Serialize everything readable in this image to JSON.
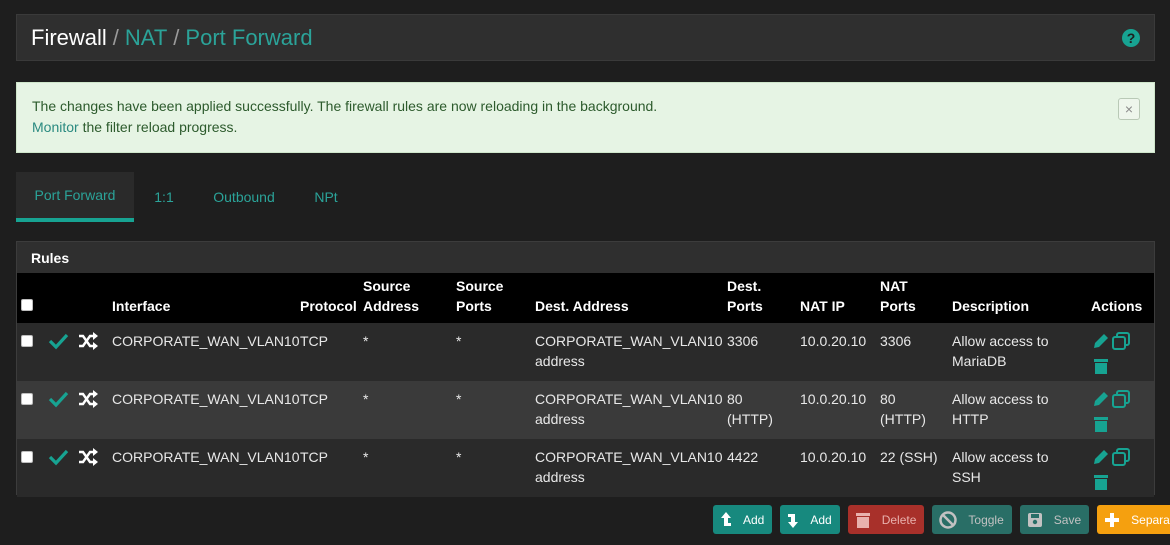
{
  "breadcrumb": {
    "root": "Firewall",
    "sep": "/",
    "nat": "NAT",
    "current": "Port Forward",
    "help": "?"
  },
  "alert": {
    "line1": "The changes have been applied successfully. The firewall rules are now reloading in the background.",
    "link": "Monitor",
    "line2_rest": " the filter reload progress.",
    "close": "×"
  },
  "tabs": [
    "Port Forward",
    "1:1",
    "Outbound",
    "NPt"
  ],
  "panel": {
    "title": "Rules",
    "headers": {
      "interface": "Interface",
      "protocol": "Protocol",
      "source_address": [
        "Source",
        "Address"
      ],
      "source_ports": [
        "Source",
        "Ports"
      ],
      "dest_address": "Dest. Address",
      "dest_ports": [
        "Dest.",
        "Ports"
      ],
      "nat_ip": "NAT IP",
      "nat_ports": [
        "NAT",
        "Ports"
      ],
      "description": "Description",
      "actions": "Actions"
    },
    "rows": [
      {
        "interface": "CORPORATE_WAN_VLAN10",
        "protocol": "TCP",
        "src_addr": "*",
        "src_ports": "*",
        "dest_addr_1": "CORPORATE_WAN_VLAN10",
        "dest_addr_2": "address",
        "dest_ports_1": "3306",
        "dest_ports_2": "",
        "nat_ip": "10.0.20.10",
        "nat_ports_1": "3306",
        "nat_ports_2": "",
        "desc_1": "Allow access to",
        "desc_2": "MariaDB"
      },
      {
        "interface": "CORPORATE_WAN_VLAN10",
        "protocol": "TCP",
        "src_addr": "*",
        "src_ports": "*",
        "dest_addr_1": "CORPORATE_WAN_VLAN10",
        "dest_addr_2": "address",
        "dest_ports_1": "80",
        "dest_ports_2": "(HTTP)",
        "nat_ip": "10.0.20.10",
        "nat_ports_1": "80",
        "nat_ports_2": "(HTTP)",
        "desc_1": "Allow access to",
        "desc_2": "HTTP"
      },
      {
        "interface": "CORPORATE_WAN_VLAN10",
        "protocol": "TCP",
        "src_addr": "*",
        "src_ports": "*",
        "dest_addr_1": "CORPORATE_WAN_VLAN10",
        "dest_addr_2": "address",
        "dest_ports_1": "4422",
        "dest_ports_2": "",
        "nat_ip": "10.0.20.10",
        "nat_ports_1": "22 (SSH)",
        "nat_ports_2": "",
        "desc_1": "Allow access to",
        "desc_2": "SSH"
      }
    ]
  },
  "buttons": {
    "add_top": "Add",
    "add_bottom": "Add",
    "delete": "Delete",
    "toggle": "Toggle",
    "save": "Save",
    "separator": "Separator"
  },
  "colors": {
    "accent": "#17a392",
    "alert_bg": "#e6f4e4",
    "delete": "#a8302a",
    "separator": "#f5a00f"
  }
}
